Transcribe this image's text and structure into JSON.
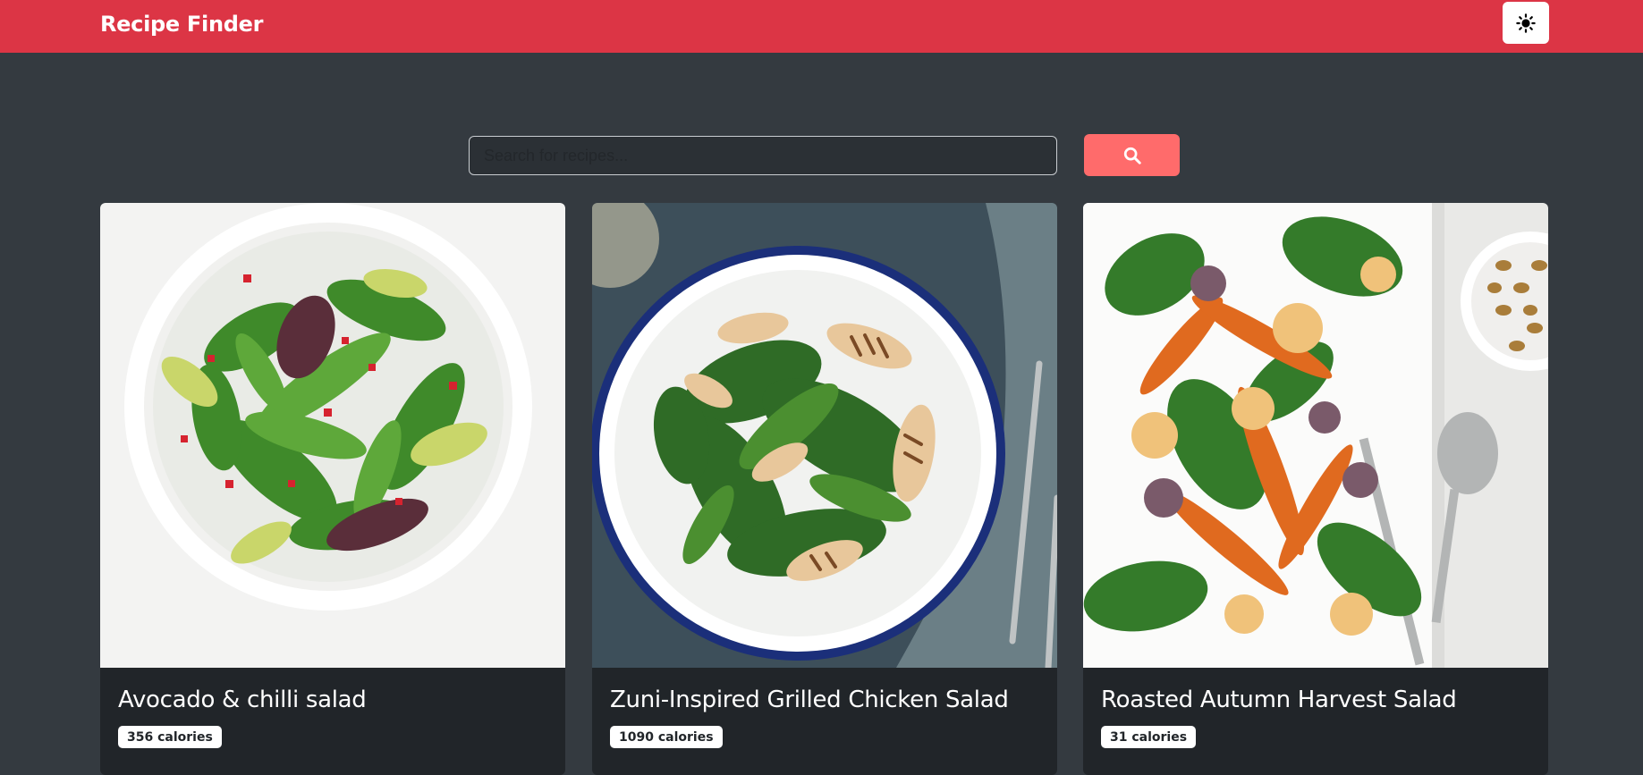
{
  "navbar": {
    "brand": "Recipe Finder",
    "theme_toggle_icon": "sun-icon",
    "color": "#dc3545"
  },
  "search": {
    "placeholder": "Search for recipes...",
    "value": "",
    "button_icon": "search-icon",
    "button_color": "#ff6b6b"
  },
  "recipes": [
    {
      "title": "Avocado & chilli salad",
      "calories": "356 calories"
    },
    {
      "title": "Zuni-Inspired Grilled Chicken Salad",
      "calories": "1090 calories"
    },
    {
      "title": "Roasted Autumn Harvest Salad",
      "calories": "31 calories"
    }
  ],
  "theme": {
    "background": "#343a40",
    "card_background": "#212529"
  }
}
